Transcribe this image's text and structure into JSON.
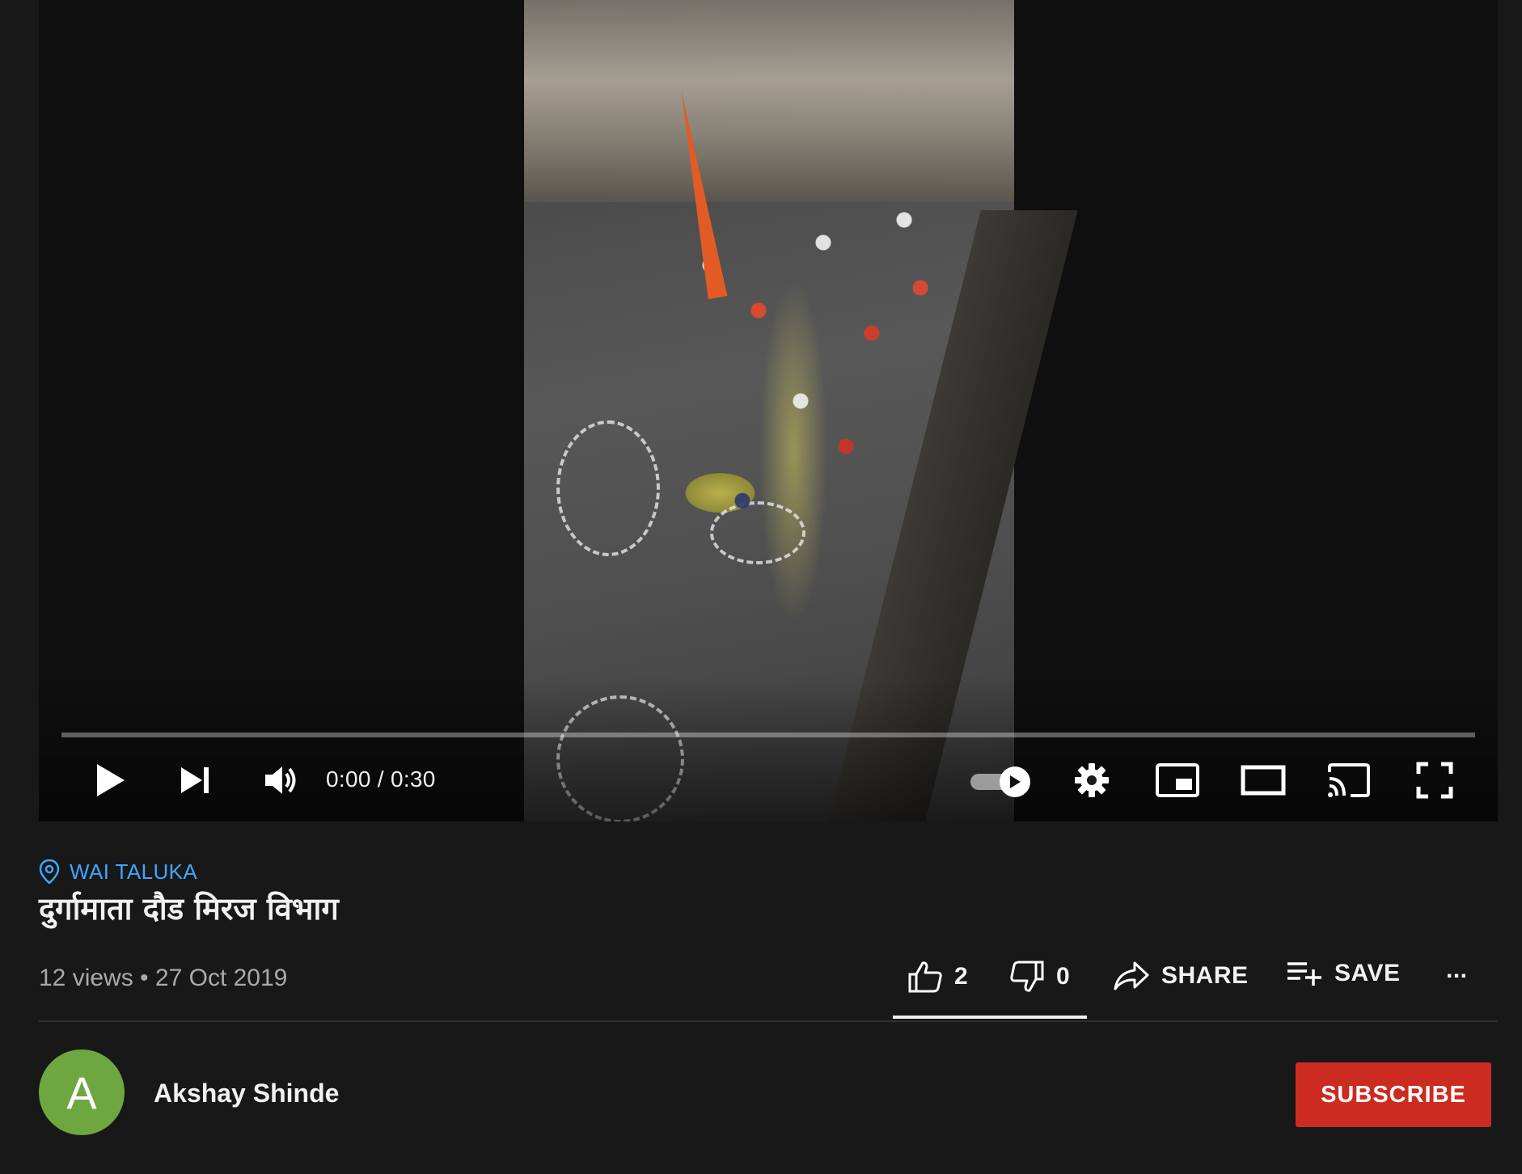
{
  "player": {
    "time_current": "0:00",
    "time_separator": " / ",
    "time_total": "0:30",
    "progress_percent": 0,
    "autoplay_on": true,
    "icons": {
      "play": "play-icon",
      "next": "next-icon",
      "volume": "volume-icon",
      "autoplay": "autoplay-toggle",
      "settings": "gear-icon",
      "miniplayer": "miniplayer-icon",
      "theater": "theater-mode-icon",
      "cast": "cast-icon",
      "fullscreen": "fullscreen-icon"
    }
  },
  "video": {
    "location": "WAI TALUKA",
    "title": "दुर्गामाता दौड मिरज विभाग",
    "views": "12 views",
    "date_separator": " • ",
    "date": "27 Oct 2019"
  },
  "actions": {
    "likes": "2",
    "dislikes": "0",
    "like_ratio": 1.0,
    "share_label": "SHARE",
    "save_label": "SAVE",
    "more_label": "..."
  },
  "channel": {
    "avatar_letter": "A",
    "avatar_color": "#6ea63f",
    "name": "Akshay Shinde",
    "subscribe_label": "SUBSCRIBE",
    "subscribe_color": "#cc2b21"
  },
  "colors": {
    "background": "#181818",
    "link": "#3ea6ff",
    "muted_text": "#aaaaaa"
  }
}
